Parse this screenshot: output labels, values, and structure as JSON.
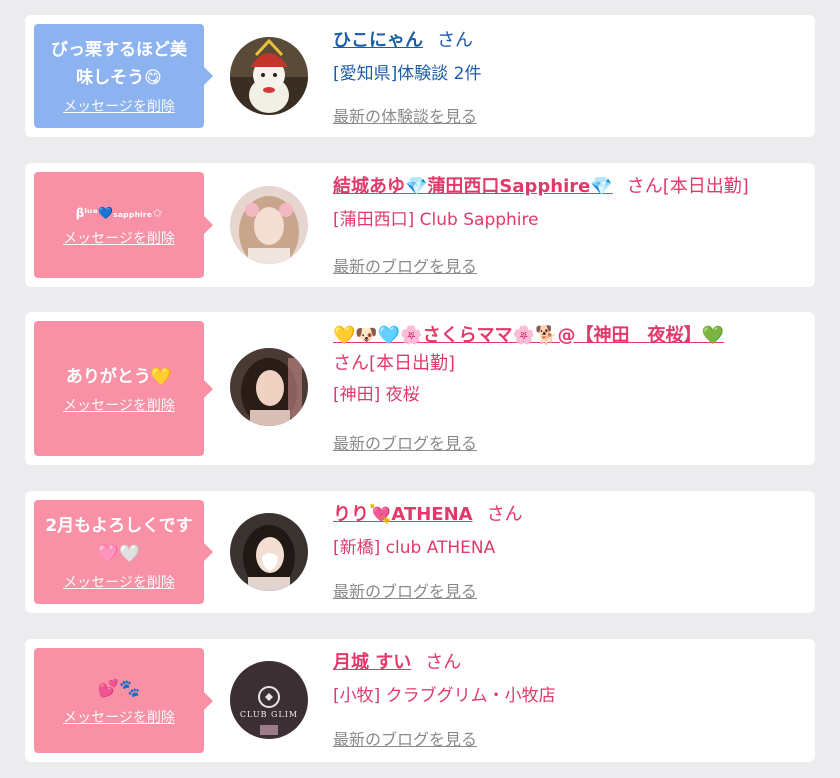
{
  "common": {
    "delete_label": "メッセージを削除"
  },
  "cards": [
    {
      "message": "びっ栗するほど美味しそう😋",
      "name": "ひこにゃん",
      "san": "さん",
      "subtitle": "[愛知県]体験談 2件",
      "link": "最新の体験談を見る"
    },
    {
      "message": "βˡᵘᵉ💙ₛₐₚₚₕᵢᵣₑ✩",
      "name": "結城あゆ💎蒲田西口Sapphire💎",
      "san": "さん[本日出勤]",
      "subtitle": "[蒲田西口] Club Sapphire",
      "link": "最新のブログを見る"
    },
    {
      "message": "ありがとう💛",
      "name": "💛🐶🩵🌸さくらママ🌸🐕@【神田　夜桜】💚",
      "san": "さん[本日出勤]",
      "subtitle": "[神田] 夜桜",
      "link": "最新のブログを見る"
    },
    {
      "message": "2月もよろしくです🩷🤍",
      "name": "りり💘ATHENA",
      "san": "さん",
      "subtitle": "[新橋] club ATHENA",
      "link": "最新のブログを見る"
    },
    {
      "message": "💕🐾",
      "name": "月城 すい",
      "san": "さん",
      "subtitle": "[小牧] クラブグリム・小牧店",
      "link": "最新のブログを見る"
    }
  ],
  "avatar_logo": "CLUB GLIM",
  "colors": {
    "blue_bubble": "#8cb2f0",
    "pink_bubble": "#f890a6",
    "blue_name": "#1d5ea8",
    "pink_name": "#e03a6a",
    "link_gray": "#8a8a8a"
  }
}
